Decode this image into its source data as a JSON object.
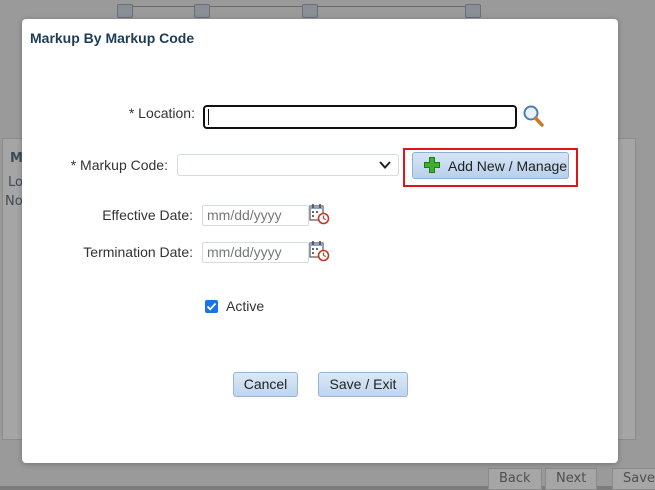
{
  "background": {
    "panel_title_partial": "M",
    "panel_row1_partial": "Lo",
    "panel_row2_partial": "No",
    "bottom_buttons": [
      "Back",
      "Next",
      "Save"
    ]
  },
  "modal": {
    "title": "Markup By Markup Code",
    "location": {
      "label": "*  Location:",
      "value": ""
    },
    "markup_code": {
      "label": "* Markup Code:",
      "selected": ""
    },
    "add_button_label": "Add New / Manage",
    "effective_date": {
      "label": "Effective Date:",
      "placeholder": "mm/dd/yyyy"
    },
    "termination_date": {
      "label": "Termination Date:",
      "placeholder": "mm/dd/yyyy"
    },
    "active": {
      "label": "Active",
      "checked": true
    },
    "cancel_label": "Cancel",
    "save_exit_label": "Save / Exit"
  },
  "colors": {
    "title": "#1f3b57",
    "button_bg": "#c9dcf1",
    "highlight": "#e01515",
    "checkbox": "#1a73e8"
  },
  "icons": [
    "search-icon",
    "chevron-down-icon",
    "plus-icon",
    "calendar-icon",
    "check-icon"
  ]
}
